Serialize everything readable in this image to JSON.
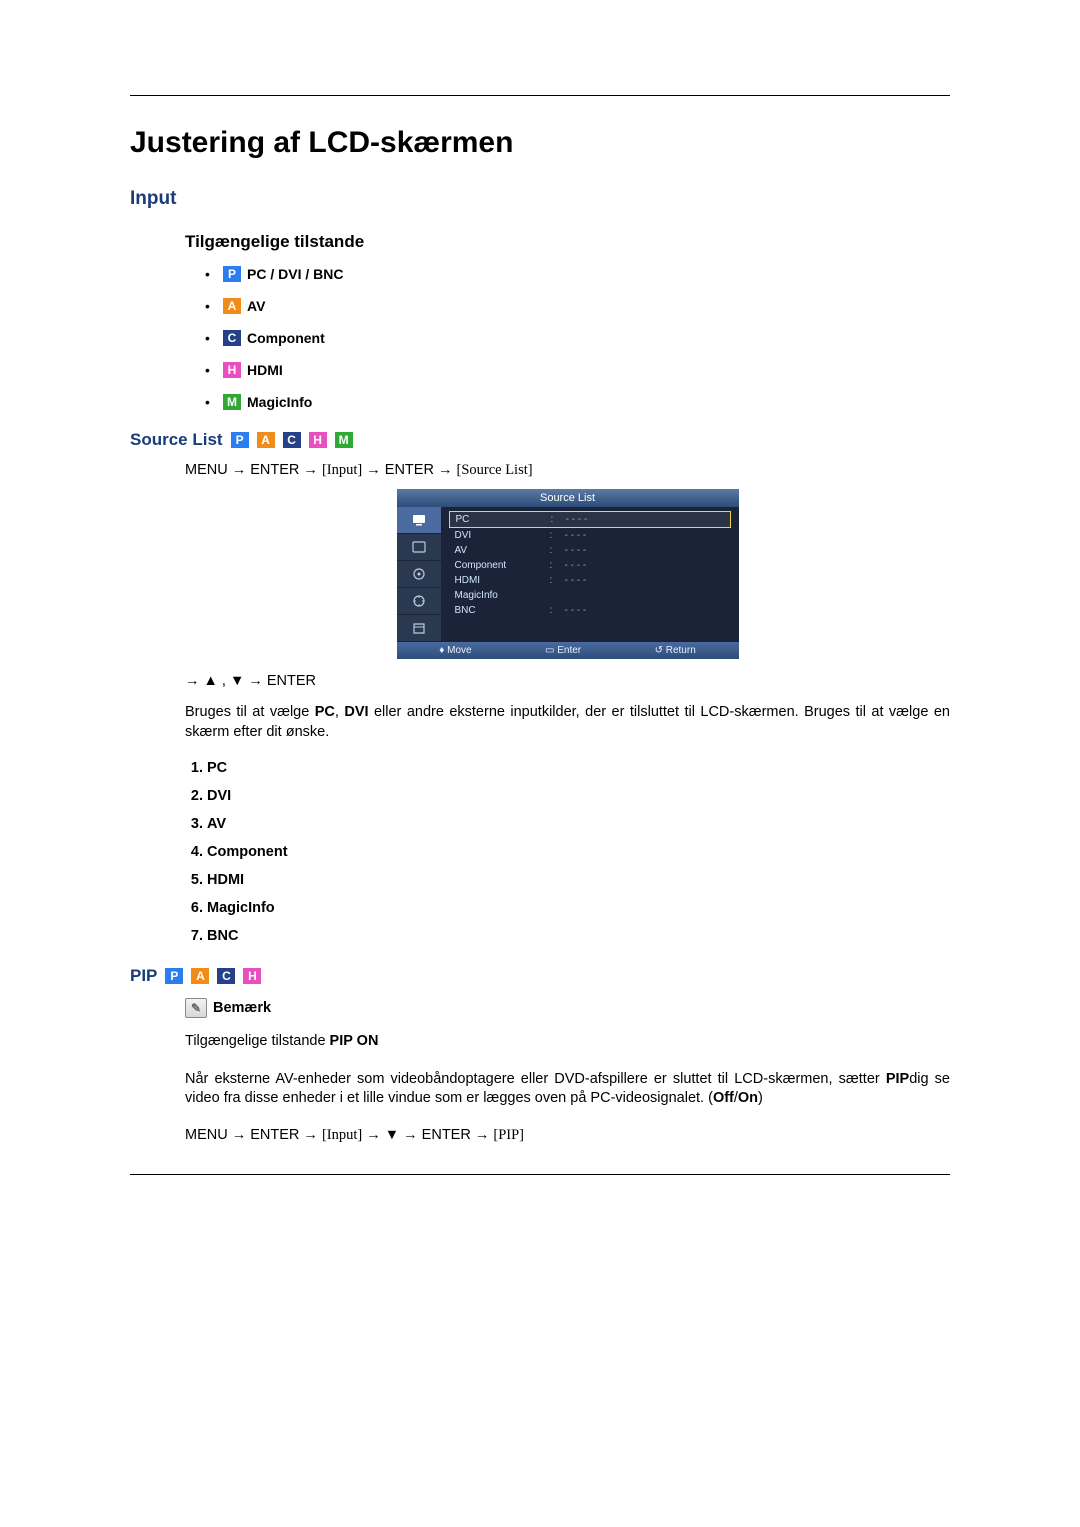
{
  "title": "Justering af LCD-skærmen",
  "sections": {
    "input": {
      "heading": "Input",
      "modes_heading": "Tilgængelige tilstande",
      "modes": [
        {
          "badge": "P",
          "label": "PC / DVI / BNC"
        },
        {
          "badge": "A",
          "label": "AV"
        },
        {
          "badge": "C",
          "label": "Component"
        },
        {
          "badge": "H",
          "label": "HDMI"
        },
        {
          "badge": "M",
          "label": "MagicInfo"
        }
      ]
    },
    "source_list": {
      "heading": "Source List",
      "badges": [
        "P",
        "A",
        "C",
        "H",
        "M"
      ],
      "path": {
        "p1": "MENU → ENTER → ",
        "input_bracket": "[Input]",
        "p2": " → ENTER → ",
        "src_bracket": "[Source List]"
      },
      "osd_menu": {
        "header": "Source List",
        "rows": [
          {
            "name": "PC",
            "val": "- - - -",
            "selected": true
          },
          {
            "name": "DVI",
            "val": "- - - -"
          },
          {
            "name": "AV",
            "val": "- - - -"
          },
          {
            "name": "Component",
            "val": "- - - -"
          },
          {
            "name": "HDMI",
            "val": "- - - -"
          },
          {
            "name": "MagicInfo",
            "val": ""
          },
          {
            "name": "BNC",
            "val": "- - - -"
          }
        ],
        "footer": {
          "move": "Move",
          "enter": "Enter",
          "return": "Return"
        }
      },
      "arrow_nav": "→ ▲ , ▼ → ENTER",
      "description_pre": "Bruges til at vælge ",
      "desc_bold1": "PC",
      "desc_mid1": ", ",
      "desc_bold2": "DVI",
      "desc_post": " eller andre eksterne inputkilder, der er tilsluttet til LCD-skærmen. Bruges til at vælge en skærm efter dit ønske.",
      "list": [
        "PC",
        "DVI",
        "AV",
        "Component",
        "HDMI",
        "MagicInfo",
        "BNC"
      ]
    },
    "pip": {
      "heading": "PIP",
      "badges": [
        "P",
        "A",
        "C",
        "H"
      ],
      "note_label": "Bemærk",
      "note_modes_pre": "Tilgængelige tilstande ",
      "note_modes_bold": "PIP ON",
      "body_pre": "Når eksterne AV-enheder som videobåndoptagere eller DVD-afspillere er sluttet til LCD-skærmen, sætter ",
      "body_bold1": "PIP",
      "body_mid": "dig se video fra disse enheder i et lille vindue som er lægges oven på PC-videosignalet. (",
      "body_bold2": "Off",
      "body_slash": "/",
      "body_bold3": "On",
      "body_end": ")",
      "path": {
        "p1": "MENU → ENTER → ",
        "input_bracket": "[Input]",
        "p2": " → ▼ → ENTER → ",
        "pip_bracket": "[PIP]"
      }
    }
  }
}
